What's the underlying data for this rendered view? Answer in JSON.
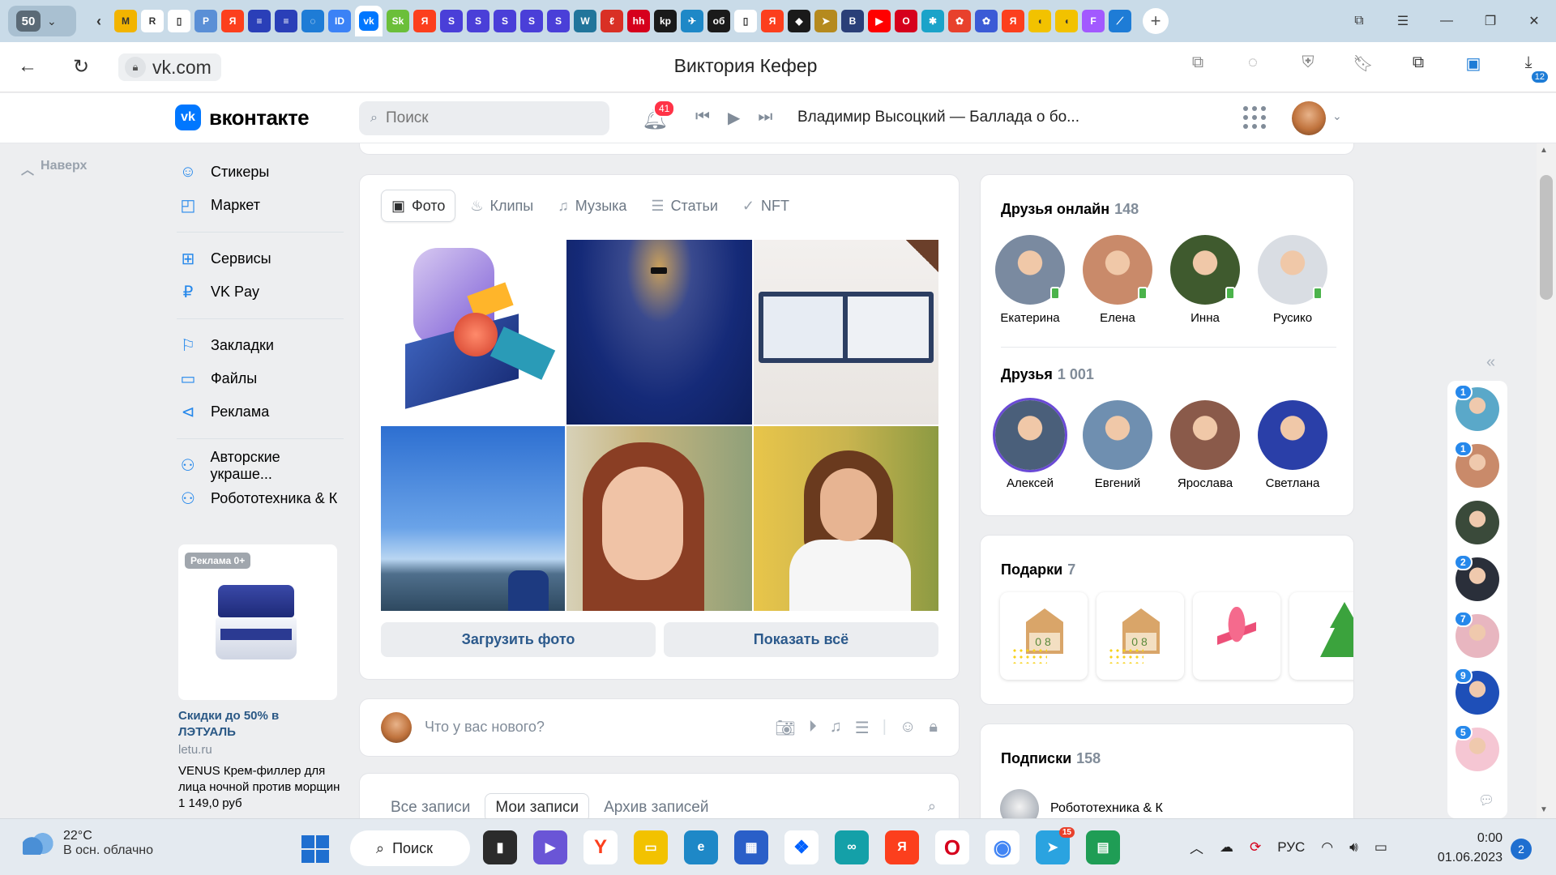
{
  "browser": {
    "tab_count": "50",
    "url": "vk.com",
    "page_title": "Виктория Кефер",
    "download_badge": "12",
    "tabs": [
      {
        "icon": "gmail-icon",
        "label": "M",
        "color": "#f2b400"
      },
      {
        "icon": "rg-icon",
        "label": "R",
        "color": "#ffffff"
      },
      {
        "icon": "doc-icon",
        "label": "▯",
        "color": "#ffffff"
      },
      {
        "icon": "pcb-icon",
        "label": "P",
        "color": "#5a8fd6"
      },
      {
        "icon": "yandex-icon",
        "label": "Я",
        "color": "#fc3f1d"
      },
      {
        "icon": "flag-icon",
        "label": "≡",
        "color": "#2a3fb8"
      },
      {
        "icon": "flag-icon",
        "label": "≡",
        "color": "#2a3fb8"
      },
      {
        "icon": "loader-icon",
        "label": "◌",
        "color": "#1e7cd6"
      },
      {
        "icon": "id-icon",
        "label": "ID",
        "color": "#3b82f6"
      },
      {
        "icon": "vk-icon",
        "label": "vk",
        "color": "#0077ff",
        "active": true
      },
      {
        "icon": "sk-icon",
        "label": "Sk",
        "color": "#6bbf3a"
      },
      {
        "icon": "yandex-icon",
        "label": "Я",
        "color": "#fc3f1d"
      },
      {
        "icon": "s-icon",
        "label": "S",
        "color": "#4a3fd8"
      },
      {
        "icon": "s-icon",
        "label": "S",
        "color": "#4a3fd8"
      },
      {
        "icon": "s-icon",
        "label": "S",
        "color": "#4a3fd8"
      },
      {
        "icon": "s-icon",
        "label": "S",
        "color": "#4a3fd8"
      },
      {
        "icon": "s-icon",
        "label": "S",
        "color": "#4a3fd8"
      },
      {
        "icon": "wordpress-icon",
        "label": "W",
        "color": "#21759b"
      },
      {
        "icon": "pen-icon",
        "label": "ℓ",
        "color": "#d93025"
      },
      {
        "icon": "hh-icon",
        "label": "hh",
        "color": "#d6001c"
      },
      {
        "icon": "radio-icon",
        "label": "kp",
        "color": "#1a1a1a"
      },
      {
        "icon": "plane-icon",
        "label": "✈",
        "color": "#1e88c7"
      },
      {
        "icon": "ob-icon",
        "label": "об",
        "color": "#1a1a1a"
      },
      {
        "icon": "doc-icon",
        "label": "▯",
        "color": "#ffffff"
      },
      {
        "icon": "yandex-icon",
        "label": "Я",
        "color": "#fc3f1d"
      },
      {
        "icon": "diamond-icon",
        "label": "◆",
        "color": "#1a1a1a"
      },
      {
        "icon": "send-icon",
        "label": "➤",
        "color": "#b58a1e"
      },
      {
        "icon": "b-icon",
        "label": "B",
        "color": "#2a3f78"
      },
      {
        "icon": "youtube-icon",
        "label": "▶",
        "color": "#ff0000"
      },
      {
        "icon": "opera-icon",
        "label": "O",
        "color": "#d6001c"
      },
      {
        "icon": "gear-icon",
        "label": "✱",
        "color": "#1aa3c9"
      },
      {
        "icon": "flower-icon",
        "label": "✿",
        "color": "#e8412c"
      },
      {
        "icon": "flower-icon",
        "label": "✿",
        "color": "#3b5bd6"
      },
      {
        "icon": "yandex-icon",
        "label": "Я",
        "color": "#fc3f1d"
      },
      {
        "icon": "duck-icon",
        "label": "◖",
        "color": "#f2c200"
      },
      {
        "icon": "duck-icon",
        "label": "◖",
        "color": "#f2c200"
      },
      {
        "icon": "figma-icon",
        "label": "F",
        "color": "#a259ff"
      },
      {
        "icon": "edge-icon",
        "label": "⟋",
        "color": "#1e7cd6"
      }
    ]
  },
  "vk": {
    "logo_text": "вконтакте",
    "search_placeholder": "Поиск",
    "notifications": "41",
    "now_playing": "Владимир Высоцкий — Баллада о бо...",
    "scroll_top": "Наверх"
  },
  "left_nav": {
    "group1": [
      {
        "icon": "smile-icon",
        "glyph": "☺",
        "label": "Стикеры"
      },
      {
        "icon": "bag-icon",
        "glyph": "◰",
        "label": "Маркет"
      }
    ],
    "group2": [
      {
        "icon": "grid-icon",
        "glyph": "⊞",
        "label": "Сервисы"
      },
      {
        "icon": "ruble-icon",
        "glyph": "₽",
        "label": "VK Pay"
      }
    ],
    "group3": [
      {
        "icon": "bookmark-icon",
        "glyph": "⚐",
        "label": "Закладки"
      },
      {
        "icon": "file-icon",
        "glyph": "▭",
        "label": "Файлы"
      },
      {
        "icon": "megaphone-icon",
        "glyph": "⊲",
        "label": "Реклама"
      }
    ],
    "group4": [
      {
        "icon": "community-icon",
        "glyph": "⚇",
        "label": "Авторские украше..."
      },
      {
        "icon": "community-icon",
        "glyph": "⚇",
        "label": "Робототехника & К"
      }
    ]
  },
  "ad": {
    "badge": "Реклама 0+",
    "title": "Скидки до 50% в ЛЭТУАЛЬ",
    "domain": "letu.ru",
    "description": "VENUS Крем-филлер для лица ночной против морщин 1 149,0 руб"
  },
  "photos": {
    "tabs": [
      {
        "icon": "photo-icon",
        "glyph": "▣",
        "label": "Фото",
        "active": true
      },
      {
        "icon": "clips-icon",
        "glyph": "♨",
        "label": "Клипы"
      },
      {
        "icon": "music-icon",
        "glyph": "♫",
        "label": "Музыка"
      },
      {
        "icon": "articles-icon",
        "glyph": "☰",
        "label": "Статьи"
      },
      {
        "icon": "nft-icon",
        "glyph": "✓",
        "label": "NFT"
      }
    ],
    "upload_button": "Загрузить фото",
    "show_all_button": "Показать всё"
  },
  "composer": {
    "placeholder": "Что у вас нового?"
  },
  "wall": {
    "tabs": [
      {
        "label": "Все записи"
      },
      {
        "label": "Мои записи",
        "active": true
      },
      {
        "label": "Архив записей"
      }
    ]
  },
  "friends_online": {
    "title": "Друзья онлайн",
    "count": "148",
    "people": [
      {
        "name": "Екатерина",
        "color": "#7a8aa0"
      },
      {
        "name": "Елена",
        "color": "#c98a6a"
      },
      {
        "name": "Инна",
        "color": "#3f5a2e"
      },
      {
        "name": "Русико",
        "color": "#d9dde3"
      }
    ]
  },
  "friends": {
    "title": "Друзья",
    "count": "1 001",
    "people": [
      {
        "name": "Алексей",
        "color": "#4a5f7a"
      },
      {
        "name": "Евгений",
        "color": "#6f8fb0"
      },
      {
        "name": "Ярослава",
        "color": "#8a5a4a"
      },
      {
        "name": "Светлана",
        "color": "#2a3fa8"
      }
    ]
  },
  "gifts": {
    "title": "Подарки",
    "count": "7",
    "digits": "08"
  },
  "subscriptions": {
    "title": "Подписки",
    "count": "158",
    "first": "Робототехника & К"
  },
  "chats": [
    {
      "unread": "1",
      "color": "#5aa8c9"
    },
    {
      "unread": "1",
      "color": "#c98a6a"
    },
    {
      "unread": "",
      "color": "#3a4a3a"
    },
    {
      "unread": "2",
      "color": "#2a2f3a"
    },
    {
      "unread": "7",
      "color": "#e8b6c0"
    },
    {
      "unread": "9",
      "color": "#1e4fb8"
    },
    {
      "unread": "5",
      "color": "#f5c6d3"
    }
  ],
  "taskbar": {
    "temp": "22°C",
    "weather": "В осн. облачно",
    "search_label": "Поиск",
    "telegram_badge": "15",
    "lang": "РУС",
    "time": "0:00",
    "date": "01.06.2023",
    "notif_count": "2"
  }
}
